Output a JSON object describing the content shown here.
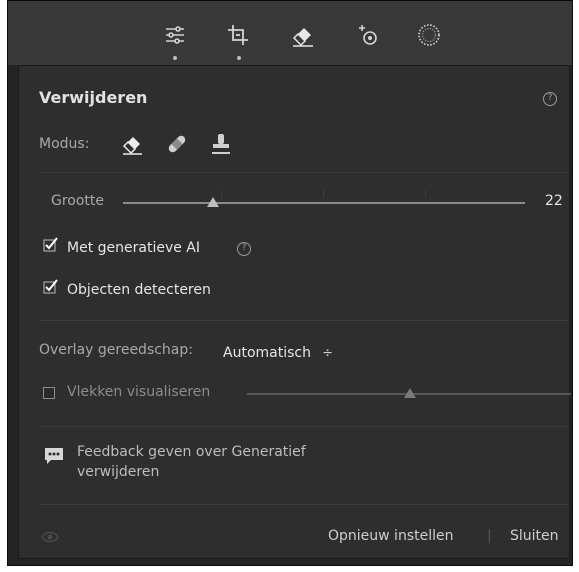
{
  "toolstrip": {
    "tools": [
      {
        "icon": "sliders-icon"
      },
      {
        "icon": "crop-icon"
      },
      {
        "icon": "eraser-icon"
      },
      {
        "icon": "redeye-icon"
      },
      {
        "icon": "masking-icon"
      }
    ]
  },
  "panel": {
    "title": "Verwijderen",
    "mode_label": "Modus:",
    "mode_icons": [
      "eraser-icon",
      "bandage-icon",
      "stamp-icon"
    ],
    "size_label": "Grootte",
    "size_value": "22",
    "size_level": 0.22,
    "ai_label": "Met generatieve AI",
    "ai_checked": true,
    "detect_label": "Objecten detecteren",
    "detect_checked": true,
    "overlay_label": "Overlay gereedschap:",
    "overlay_value": "Automatisch",
    "overlay_arrow": "÷",
    "spots_label": "Vlekken visualiseren",
    "spots_checked": false,
    "spots_level": 0.5,
    "feedback_line1": "Feedback geven over Generatief",
    "feedback_line2": "verwijderen",
    "reset_label": "Opnieuw instellen",
    "divider": "|",
    "close_label": "Sluiten"
  },
  "colors": {
    "accent_text": "#e6e6e6",
    "muted_text": "#a9a9a9",
    "panel_bg": "#2e2e2e",
    "strip_bg": "#383838"
  }
}
